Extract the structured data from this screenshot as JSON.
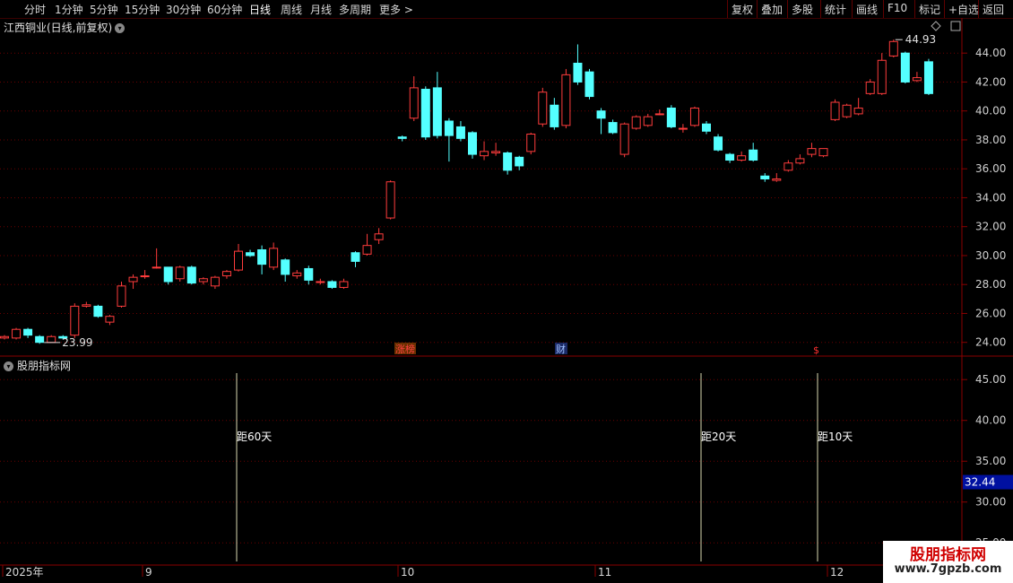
{
  "toolbar": {
    "periods": [
      "分时",
      "1分钟",
      "5分钟",
      "15分钟",
      "30分钟",
      "60分钟",
      "日线",
      "周线",
      "月线",
      "多周期",
      "更多 >"
    ],
    "active_period": "日线",
    "actions": [
      "复权",
      "叠加",
      "多股",
      "统计",
      "画线",
      "F10",
      "标记",
      "+自选",
      "返回"
    ]
  },
  "chart_title": "江西铜业(日线,前复权)",
  "panel_title": "股朋指标网",
  "price_axis": [
    "44.00",
    "42.00",
    "40.00",
    "38.00",
    "36.00",
    "34.00",
    "32.00",
    "30.00",
    "28.00",
    "26.00",
    "24.00"
  ],
  "indicator_axis": [
    "45.00",
    "40.00",
    "35.00",
    "30.00",
    "25.00"
  ],
  "indicator_highlight_value": "32.44",
  "max_label": "44.93",
  "min_label": "23.99",
  "markers": {
    "zhangbang": "涨榜",
    "cai": "财",
    "dollar": "$"
  },
  "distance_labels": [
    "距60天",
    "距20天",
    "距10天"
  ],
  "date_axis": [
    "2025年",
    "9",
    "10",
    "11",
    "12"
  ],
  "watermark": {
    "title": "股朋指标网",
    "url": "www.7gpzb.com"
  },
  "colors": {
    "up": "#ff3c3c",
    "down": "#54ffff",
    "grid": "#6a0000",
    "border": "#8a0000"
  },
  "chart_data": {
    "type": "candlestick",
    "ylim": [
      23.3,
      45.5
    ],
    "candles": [
      [
        24.3,
        24.4,
        24.2,
        24.5
      ],
      [
        24.3,
        24.9,
        24.2,
        25.0
      ],
      [
        24.9,
        24.5,
        24.3,
        25.0
      ],
      [
        24.4,
        24.0,
        23.9,
        24.5
      ],
      [
        24.0,
        24.4,
        23.99,
        24.5
      ],
      [
        24.4,
        24.3,
        24.2,
        24.5
      ],
      [
        24.5,
        26.5,
        24.3,
        26.7
      ],
      [
        26.5,
        26.6,
        26.4,
        26.8
      ],
      [
        26.5,
        25.8,
        25.7,
        26.6
      ],
      [
        25.4,
        25.8,
        25.2,
        25.9
      ],
      [
        26.5,
        27.9,
        26.4,
        28.2
      ],
      [
        28.2,
        28.5,
        27.7,
        28.7
      ],
      [
        28.6,
        28.6,
        28.4,
        29.0
      ],
      [
        29.2,
        29.2,
        29.1,
        30.5
      ],
      [
        29.2,
        28.2,
        28.0,
        29.2
      ],
      [
        28.4,
        29.2,
        28.2,
        29.3
      ],
      [
        29.2,
        28.1,
        28.0,
        29.3
      ],
      [
        28.2,
        28.4,
        28.0,
        28.5
      ],
      [
        27.9,
        28.5,
        27.7,
        28.6
      ],
      [
        28.6,
        28.9,
        28.4,
        29.0
      ],
      [
        29.0,
        30.3,
        28.9,
        30.8
      ],
      [
        30.2,
        30.0,
        29.9,
        30.4
      ],
      [
        30.4,
        29.4,
        28.7,
        30.7
      ],
      [
        29.2,
        30.5,
        29.0,
        30.9
      ],
      [
        29.7,
        28.7,
        28.2,
        29.8
      ],
      [
        28.6,
        28.8,
        28.4,
        29.0
      ],
      [
        29.1,
        28.3,
        28.0,
        29.3
      ],
      [
        28.2,
        28.2,
        28.0,
        28.4
      ],
      [
        28.2,
        27.8,
        27.7,
        28.3
      ],
      [
        27.8,
        28.2,
        27.7,
        28.4
      ],
      [
        30.2,
        29.6,
        29.2,
        30.3
      ],
      [
        30.1,
        30.7,
        30.0,
        31.5
      ],
      [
        31.1,
        31.5,
        30.8,
        31.9
      ],
      [
        32.6,
        35.1,
        32.5,
        35.2
      ],
      [
        38.2,
        38.1,
        37.9,
        38.3
      ],
      [
        39.5,
        41.6,
        39.3,
        42.4
      ],
      [
        41.5,
        38.2,
        38.0,
        41.7
      ],
      [
        41.6,
        38.3,
        38.1,
        42.7
      ],
      [
        39.3,
        38.3,
        36.5,
        39.5
      ],
      [
        38.9,
        38.1,
        37.9,
        39.3
      ],
      [
        38.5,
        37.0,
        36.7,
        38.6
      ],
      [
        36.9,
        37.2,
        36.6,
        37.9
      ],
      [
        37.1,
        37.2,
        36.9,
        37.8
      ],
      [
        37.1,
        35.9,
        35.6,
        37.2
      ],
      [
        36.8,
        36.2,
        35.9,
        36.9
      ],
      [
        37.2,
        38.4,
        37.0,
        38.5
      ],
      [
        39.1,
        41.3,
        38.9,
        41.6
      ],
      [
        40.4,
        38.9,
        38.7,
        40.9
      ],
      [
        39.0,
        42.5,
        38.8,
        42.9
      ],
      [
        43.3,
        42.0,
        41.8,
        44.6
      ],
      [
        42.7,
        41.0,
        40.8,
        42.9
      ],
      [
        40.0,
        39.5,
        38.4,
        40.2
      ],
      [
        39.2,
        38.5,
        38.4,
        39.4
      ],
      [
        37.0,
        39.1,
        36.8,
        39.2
      ],
      [
        38.8,
        39.6,
        38.7,
        39.7
      ],
      [
        39.0,
        39.6,
        38.9,
        39.8
      ],
      [
        39.8,
        39.8,
        39.7,
        40.1
      ],
      [
        40.2,
        38.9,
        38.8,
        40.4
      ],
      [
        38.8,
        38.8,
        38.5,
        39.1
      ],
      [
        39.0,
        40.2,
        38.9,
        40.3
      ],
      [
        39.1,
        38.6,
        38.4,
        39.3
      ],
      [
        38.2,
        37.3,
        37.2,
        38.4
      ],
      [
        37.0,
        36.6,
        36.4,
        37.1
      ],
      [
        36.6,
        36.9,
        36.5,
        37.2
      ],
      [
        37.3,
        36.6,
        36.5,
        37.8
      ],
      [
        35.5,
        35.3,
        35.1,
        35.7
      ],
      [
        35.2,
        35.3,
        35.1,
        35.7
      ],
      [
        35.9,
        36.4,
        35.8,
        36.6
      ],
      [
        36.4,
        36.7,
        36.3,
        37.0
      ],
      [
        37.0,
        37.4,
        36.8,
        37.8
      ],
      [
        36.9,
        37.4,
        36.8,
        37.4
      ],
      [
        39.4,
        40.6,
        39.3,
        40.8
      ],
      [
        39.6,
        40.4,
        39.5,
        40.5
      ],
      [
        39.8,
        40.2,
        39.7,
        40.9
      ],
      [
        41.2,
        42.0,
        41.1,
        42.2
      ],
      [
        41.2,
        43.5,
        41.1,
        44.0
      ],
      [
        43.8,
        44.8,
        43.7,
        44.93
      ],
      [
        44.0,
        42.0,
        41.9,
        44.1
      ],
      [
        42.1,
        42.3,
        42.0,
        42.7
      ],
      [
        43.4,
        41.2,
        41.1,
        43.6
      ]
    ],
    "indicator": {
      "ylim": [
        22.5,
        47.0
      ],
      "highlight": 32.44
    },
    "x_labels": [
      "2025年",
      "9",
      "10",
      "11",
      "12"
    ],
    "grid": true
  }
}
